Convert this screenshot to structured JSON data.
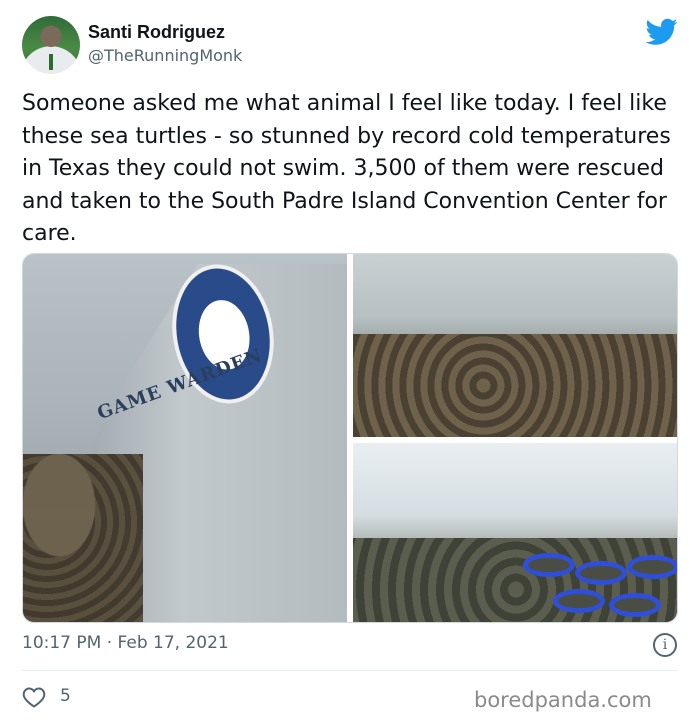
{
  "author": {
    "name": "Santi Rodriguez",
    "handle": "@TheRunningMonk"
  },
  "tweet": {
    "text": "Someone asked me what animal I feel like today. I feel like these sea turtles - so stunned by record cold temperatures in Texas they could not swim. 3,500 of them were rescued and taken to the South Padre Island Convention Center for care.",
    "timestamp": "10:17 PM · Feb 17, 2021",
    "like_count": "5"
  },
  "media": {
    "photo1": {
      "boat_text": "GAME WARDEN"
    }
  },
  "footer": {
    "source": "boredpanda.com"
  },
  "colors": {
    "twitter_blue": "#1d9bf0",
    "secondary_text": "#536471"
  },
  "icons": [
    "twitter-bird-icon",
    "info-icon",
    "heart-icon"
  ]
}
